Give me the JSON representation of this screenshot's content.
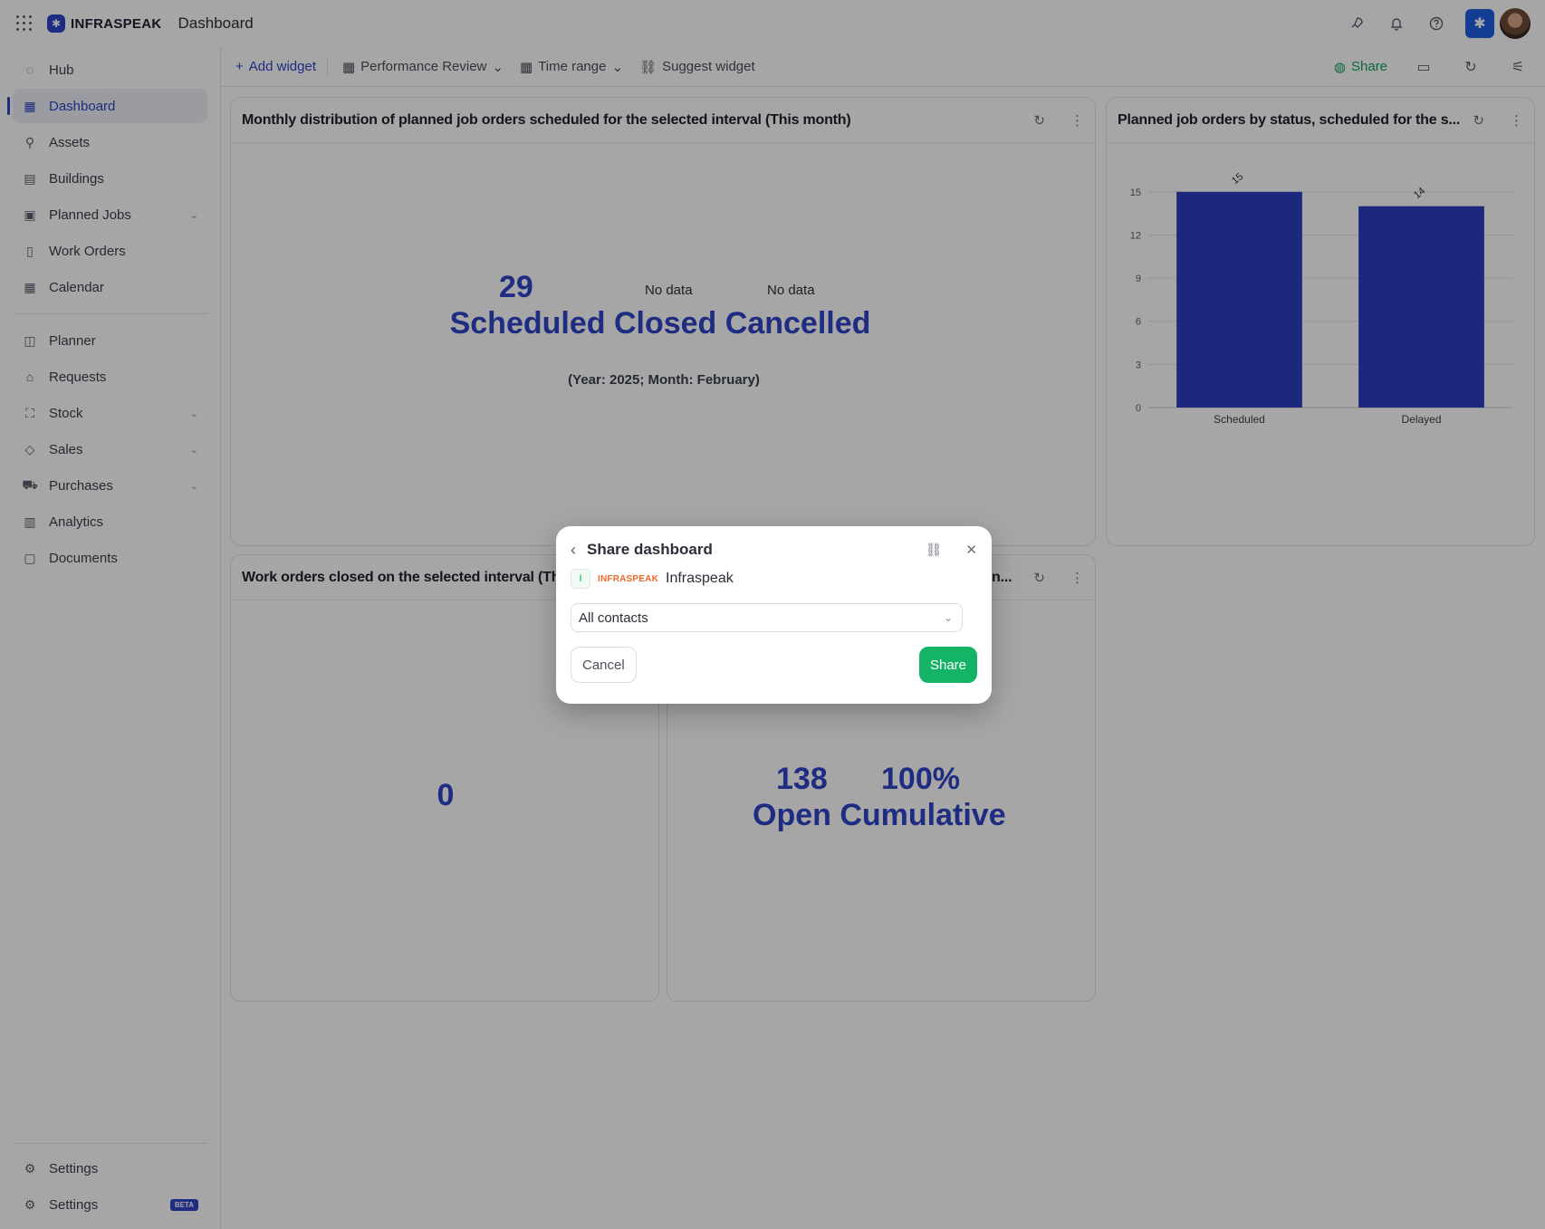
{
  "header": {
    "brand": "INFRASPEAK",
    "title": "Dashboard"
  },
  "icons": {
    "brand_color": "#2f44c8",
    "success_color": "#15b366"
  },
  "sidebar": {
    "items": [
      {
        "label": "Hub"
      },
      {
        "label": "Dashboard",
        "active": true
      },
      {
        "label": "Assets"
      },
      {
        "label": "Buildings"
      },
      {
        "label": "Planned Jobs"
      },
      {
        "label": "Work Orders"
      },
      {
        "label": "Calendar"
      },
      {
        "label": "Planner"
      },
      {
        "label": "Requests"
      },
      {
        "label": "Stock"
      },
      {
        "label": "Sales"
      },
      {
        "label": "Purchases"
      },
      {
        "label": "Analytics"
      },
      {
        "label": "Documents"
      }
    ],
    "bottom": [
      {
        "label": "Settings"
      },
      {
        "label": "Settings",
        "badge": "BETA"
      }
    ]
  },
  "toolbar": {
    "add_widget": "Add widget",
    "view": "Performance Review",
    "time_range": "Time range",
    "suggest": "Suggest widget",
    "share": "Share"
  },
  "widgets": {
    "w1": {
      "title": "Monthly distribution of planned job orders scheduled for the selected interval (This month)",
      "value": "29",
      "no_data_1": "No data",
      "no_data_2": "No data",
      "labels": "Scheduled Closed Cancelled",
      "period": "(Year: 2025; Month: February)"
    },
    "w2": {
      "title": "Planned job orders by status, scheduled for the s..."
    },
    "w3": {
      "title": "Work orders closed on the selected interval (This ...",
      "value": "0"
    },
    "w4": {
      "title": "n...",
      "value_1": "138",
      "value_2": "100%",
      "labels": "Open Cumulative"
    }
  },
  "chart_data": {
    "type": "bar",
    "categories": [
      "Scheduled",
      "Delayed"
    ],
    "values": [
      15,
      14
    ],
    "ylim": [
      0,
      16.5
    ],
    "yticks": [
      0,
      3,
      6,
      9,
      12,
      15
    ],
    "bar_color": "#2a3ec0",
    "grid": true
  },
  "modal": {
    "title": "Share dashboard",
    "org_initial": "I",
    "org_tag": "INFRASPEAK",
    "org_name": "Infraspeak",
    "select_value": "All contacts",
    "cancel": "Cancel",
    "share": "Share"
  }
}
